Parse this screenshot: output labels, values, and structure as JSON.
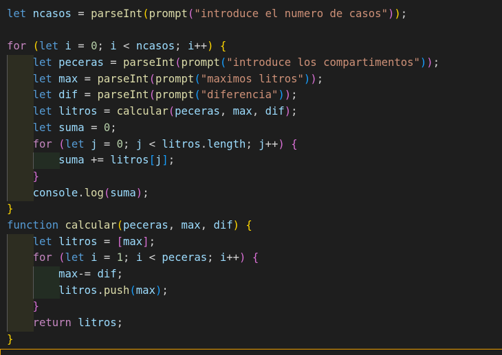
{
  "editor": {
    "language": "javascript",
    "theme_colors": {
      "background": "#1e1e1e",
      "keyword_declaration": "#569cd6",
      "keyword_control": "#c586c0",
      "variable": "#9cdcfe",
      "function": "#dcdcaa",
      "string": "#ce9178",
      "number": "#b5cea8"
    },
    "lines": [
      {
        "indent": 0,
        "tokens": [
          {
            "c": "kw-blue",
            "t": "let"
          },
          {
            "c": "op",
            "t": " "
          },
          {
            "c": "var",
            "t": "ncasos"
          },
          {
            "c": "op",
            "t": " = "
          },
          {
            "c": "fn",
            "t": "parseInt"
          },
          {
            "c": "br-gold",
            "t": "("
          },
          {
            "c": "fn",
            "t": "prompt"
          },
          {
            "c": "br-pink",
            "t": "("
          },
          {
            "c": "str",
            "t": "\"introduce el numero de casos\""
          },
          {
            "c": "br-pink",
            "t": ")"
          },
          {
            "c": "br-gold",
            "t": ")"
          },
          {
            "c": "op",
            "t": ";"
          }
        ]
      },
      {
        "indent": 0,
        "tokens": []
      },
      {
        "indent": 0,
        "tokens": [
          {
            "c": "kw-ctrl",
            "t": "for"
          },
          {
            "c": "op",
            "t": " "
          },
          {
            "c": "br-gold",
            "t": "("
          },
          {
            "c": "kw-blue",
            "t": "let"
          },
          {
            "c": "op",
            "t": " "
          },
          {
            "c": "var",
            "t": "i"
          },
          {
            "c": "op",
            "t": " = "
          },
          {
            "c": "num",
            "t": "0"
          },
          {
            "c": "op",
            "t": "; "
          },
          {
            "c": "var",
            "t": "i"
          },
          {
            "c": "op",
            "t": " < "
          },
          {
            "c": "var",
            "t": "ncasos"
          },
          {
            "c": "op",
            "t": "; "
          },
          {
            "c": "var",
            "t": "i"
          },
          {
            "c": "op",
            "t": "++"
          },
          {
            "c": "br-gold",
            "t": ")"
          },
          {
            "c": "op",
            "t": " "
          },
          {
            "c": "br-gold",
            "t": "{"
          }
        ]
      },
      {
        "indent": 1,
        "tokens": [
          {
            "c": "kw-blue",
            "t": "let"
          },
          {
            "c": "op",
            "t": " "
          },
          {
            "c": "var",
            "t": "peceras"
          },
          {
            "c": "op",
            "t": " = "
          },
          {
            "c": "fn",
            "t": "parseInt"
          },
          {
            "c": "br-pink",
            "t": "("
          },
          {
            "c": "fn",
            "t": "prompt"
          },
          {
            "c": "br-blue",
            "t": "("
          },
          {
            "c": "str",
            "t": "\"introduce los compartimentos\""
          },
          {
            "c": "br-blue",
            "t": ")"
          },
          {
            "c": "br-pink",
            "t": ")"
          },
          {
            "c": "op",
            "t": ";"
          }
        ]
      },
      {
        "indent": 1,
        "tokens": [
          {
            "c": "kw-blue",
            "t": "let"
          },
          {
            "c": "op",
            "t": " "
          },
          {
            "c": "var",
            "t": "max"
          },
          {
            "c": "op",
            "t": " = "
          },
          {
            "c": "fn",
            "t": "parseInt"
          },
          {
            "c": "br-pink",
            "t": "("
          },
          {
            "c": "fn",
            "t": "prompt"
          },
          {
            "c": "br-blue",
            "t": "("
          },
          {
            "c": "str",
            "t": "\"maximos litros\""
          },
          {
            "c": "br-blue",
            "t": ")"
          },
          {
            "c": "br-pink",
            "t": ")"
          },
          {
            "c": "op",
            "t": ";"
          }
        ]
      },
      {
        "indent": 1,
        "tokens": [
          {
            "c": "kw-blue",
            "t": "let"
          },
          {
            "c": "op",
            "t": " "
          },
          {
            "c": "var",
            "t": "dif"
          },
          {
            "c": "op",
            "t": " = "
          },
          {
            "c": "fn",
            "t": "parseInt"
          },
          {
            "c": "br-pink",
            "t": "("
          },
          {
            "c": "fn",
            "t": "prompt"
          },
          {
            "c": "br-blue",
            "t": "("
          },
          {
            "c": "str",
            "t": "\"diferencia\""
          },
          {
            "c": "br-blue",
            "t": ")"
          },
          {
            "c": "br-pink",
            "t": ")"
          },
          {
            "c": "op",
            "t": ";"
          }
        ]
      },
      {
        "indent": 1,
        "tokens": [
          {
            "c": "kw-blue",
            "t": "let"
          },
          {
            "c": "op",
            "t": " "
          },
          {
            "c": "var",
            "t": "litros"
          },
          {
            "c": "op",
            "t": " = "
          },
          {
            "c": "fn",
            "t": "calcular"
          },
          {
            "c": "br-pink",
            "t": "("
          },
          {
            "c": "var",
            "t": "peceras"
          },
          {
            "c": "op",
            "t": ", "
          },
          {
            "c": "var",
            "t": "max"
          },
          {
            "c": "op",
            "t": ", "
          },
          {
            "c": "var",
            "t": "dif"
          },
          {
            "c": "br-pink",
            "t": ")"
          },
          {
            "c": "op",
            "t": ";"
          }
        ]
      },
      {
        "indent": 1,
        "tokens": [
          {
            "c": "kw-blue",
            "t": "let"
          },
          {
            "c": "op",
            "t": " "
          },
          {
            "c": "var",
            "t": "suma"
          },
          {
            "c": "op",
            "t": " = "
          },
          {
            "c": "num",
            "t": "0"
          },
          {
            "c": "op",
            "t": ";"
          }
        ]
      },
      {
        "indent": 1,
        "tokens": [
          {
            "c": "kw-ctrl",
            "t": "for"
          },
          {
            "c": "op",
            "t": " "
          },
          {
            "c": "br-pink",
            "t": "("
          },
          {
            "c": "kw-blue",
            "t": "let"
          },
          {
            "c": "op",
            "t": " "
          },
          {
            "c": "var",
            "t": "j"
          },
          {
            "c": "op",
            "t": " = "
          },
          {
            "c": "num",
            "t": "0"
          },
          {
            "c": "op",
            "t": "; "
          },
          {
            "c": "var",
            "t": "j"
          },
          {
            "c": "op",
            "t": " < "
          },
          {
            "c": "var",
            "t": "litros"
          },
          {
            "c": "op",
            "t": "."
          },
          {
            "c": "var",
            "t": "length"
          },
          {
            "c": "op",
            "t": "; "
          },
          {
            "c": "var",
            "t": "j"
          },
          {
            "c": "op",
            "t": "++"
          },
          {
            "c": "br-pink",
            "t": ")"
          },
          {
            "c": "op",
            "t": " "
          },
          {
            "c": "br-pink",
            "t": "{"
          }
        ]
      },
      {
        "indent": 2,
        "tokens": [
          {
            "c": "var",
            "t": "suma"
          },
          {
            "c": "op",
            "t": " += "
          },
          {
            "c": "var",
            "t": "litros"
          },
          {
            "c": "br-blue",
            "t": "["
          },
          {
            "c": "var",
            "t": "j"
          },
          {
            "c": "br-blue",
            "t": "]"
          },
          {
            "c": "op",
            "t": ";"
          }
        ]
      },
      {
        "indent": 1,
        "tokens": [
          {
            "c": "br-pink",
            "t": "}"
          }
        ]
      },
      {
        "indent": 1,
        "tokens": [
          {
            "c": "var",
            "t": "console"
          },
          {
            "c": "op",
            "t": "."
          },
          {
            "c": "fn",
            "t": "log"
          },
          {
            "c": "br-pink",
            "t": "("
          },
          {
            "c": "var",
            "t": "suma"
          },
          {
            "c": "br-pink",
            "t": ")"
          },
          {
            "c": "op",
            "t": ";"
          }
        ]
      },
      {
        "indent": 0,
        "tokens": [
          {
            "c": "br-gold",
            "t": "}"
          }
        ]
      },
      {
        "indent": 0,
        "tokens": [
          {
            "c": "kw-blue",
            "t": "function"
          },
          {
            "c": "op",
            "t": " "
          },
          {
            "c": "fn",
            "t": "calcular"
          },
          {
            "c": "br-gold",
            "t": "("
          },
          {
            "c": "var",
            "t": "peceras"
          },
          {
            "c": "op",
            "t": ", "
          },
          {
            "c": "var",
            "t": "max"
          },
          {
            "c": "op",
            "t": ", "
          },
          {
            "c": "var",
            "t": "dif"
          },
          {
            "c": "br-gold",
            "t": ")"
          },
          {
            "c": "op",
            "t": " "
          },
          {
            "c": "br-gold",
            "t": "{"
          }
        ]
      },
      {
        "indent": 1,
        "tokens": [
          {
            "c": "kw-blue",
            "t": "let"
          },
          {
            "c": "op",
            "t": " "
          },
          {
            "c": "var",
            "t": "litros"
          },
          {
            "c": "op",
            "t": " = "
          },
          {
            "c": "br-pink",
            "t": "["
          },
          {
            "c": "var",
            "t": "max"
          },
          {
            "c": "br-pink",
            "t": "]"
          },
          {
            "c": "op",
            "t": ";"
          }
        ]
      },
      {
        "indent": 1,
        "tokens": [
          {
            "c": "kw-ctrl",
            "t": "for"
          },
          {
            "c": "op",
            "t": " "
          },
          {
            "c": "br-pink",
            "t": "("
          },
          {
            "c": "kw-blue",
            "t": "let"
          },
          {
            "c": "op",
            "t": " "
          },
          {
            "c": "var",
            "t": "i"
          },
          {
            "c": "op",
            "t": " = "
          },
          {
            "c": "num",
            "t": "1"
          },
          {
            "c": "op",
            "t": "; "
          },
          {
            "c": "var",
            "t": "i"
          },
          {
            "c": "op",
            "t": " < "
          },
          {
            "c": "var",
            "t": "peceras"
          },
          {
            "c": "op",
            "t": "; "
          },
          {
            "c": "var",
            "t": "i"
          },
          {
            "c": "op",
            "t": "++"
          },
          {
            "c": "br-pink",
            "t": ")"
          },
          {
            "c": "op",
            "t": " "
          },
          {
            "c": "br-pink",
            "t": "{"
          }
        ]
      },
      {
        "indent": 2,
        "tokens": [
          {
            "c": "var",
            "t": "max"
          },
          {
            "c": "op",
            "t": "-= "
          },
          {
            "c": "var",
            "t": "dif"
          },
          {
            "c": "op",
            "t": ";"
          }
        ]
      },
      {
        "indent": 2,
        "tokens": [
          {
            "c": "var",
            "t": "litros"
          },
          {
            "c": "op",
            "t": "."
          },
          {
            "c": "fn",
            "t": "push"
          },
          {
            "c": "br-blue",
            "t": "("
          },
          {
            "c": "var",
            "t": "max"
          },
          {
            "c": "br-blue",
            "t": ")"
          },
          {
            "c": "op",
            "t": ";"
          }
        ]
      },
      {
        "indent": 1,
        "tokens": [
          {
            "c": "br-pink",
            "t": "}"
          }
        ]
      },
      {
        "indent": 1,
        "tokens": [
          {
            "c": "kw-ctrl",
            "t": "return"
          },
          {
            "c": "op",
            "t": " "
          },
          {
            "c": "var",
            "t": "litros"
          },
          {
            "c": "op",
            "t": ";"
          }
        ]
      },
      {
        "indent": 0,
        "tokens": [
          {
            "c": "br-gold",
            "t": "}"
          }
        ]
      }
    ]
  }
}
